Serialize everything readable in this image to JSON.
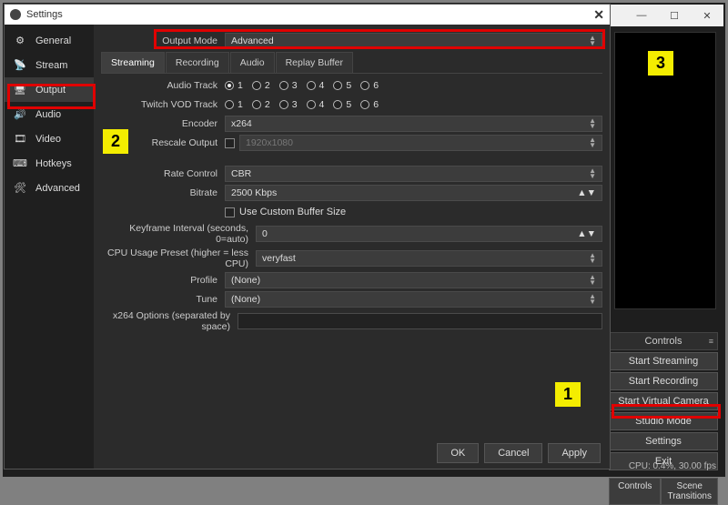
{
  "bg_window": {
    "min": "—",
    "max": "☐",
    "close": "✕"
  },
  "controls": {
    "header": "Controls",
    "buttons": [
      "Start Streaming",
      "Start Recording",
      "Start Virtual Camera",
      "Studio Mode",
      "Settings",
      "Exit"
    ],
    "tabs": [
      "Controls",
      "Scene Transitions"
    ]
  },
  "status": "CPU: 0.4%, 30.00 fps",
  "callouts": {
    "c1": "1",
    "c2": "2",
    "c3": "3"
  },
  "settings": {
    "title": "Settings",
    "close": "✕",
    "sidebar": [
      {
        "icon": "⚙",
        "label": "General"
      },
      {
        "icon": "📡",
        "label": "Stream"
      },
      {
        "icon": "🖥",
        "label": "Output"
      },
      {
        "icon": "🔊",
        "label": "Audio"
      },
      {
        "icon": "🎞",
        "label": "Video"
      },
      {
        "icon": "⌨",
        "label": "Hotkeys"
      },
      {
        "icon": "🛠",
        "label": "Advanced"
      }
    ],
    "output_mode": {
      "label": "Output Mode",
      "value": "Advanced"
    },
    "subtabs": [
      "Streaming",
      "Recording",
      "Audio",
      "Replay Buffer"
    ],
    "audio_track_label": "Audio Track",
    "twitch_vod_label": "Twitch VOD Track",
    "tracks": [
      "1",
      "2",
      "3",
      "4",
      "5",
      "6"
    ],
    "encoder": {
      "label": "Encoder",
      "value": "x264"
    },
    "rescale": {
      "label": "Rescale Output",
      "value": "1920x1080"
    },
    "rate_control": {
      "label": "Rate Control",
      "value": "CBR"
    },
    "bitrate": {
      "label": "Bitrate",
      "value": "2500 Kbps"
    },
    "custom_buffer": "Use Custom Buffer Size",
    "keyframe": {
      "label": "Keyframe Interval (seconds, 0=auto)",
      "value": "0"
    },
    "cpu_preset": {
      "label": "CPU Usage Preset (higher = less CPU)",
      "value": "veryfast"
    },
    "profile": {
      "label": "Profile",
      "value": "(None)"
    },
    "tune": {
      "label": "Tune",
      "value": "(None)"
    },
    "x264_opts": {
      "label": "x264 Options (separated by space)"
    },
    "buttons": {
      "ok": "OK",
      "cancel": "Cancel",
      "apply": "Apply"
    }
  }
}
